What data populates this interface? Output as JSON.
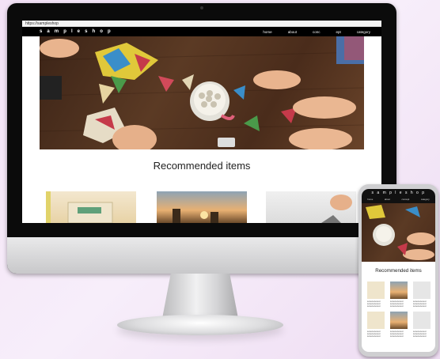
{
  "browser": {
    "url": "https://sampleshop"
  },
  "site": {
    "brand": "s a m p l e s h o p",
    "nav": [
      "home",
      "about",
      "conc",
      "ept",
      "category"
    ]
  },
  "main": {
    "section_title": "Recommended items"
  },
  "mobile": {
    "brand": "s a m p l e s h o p",
    "nav": [
      "home",
      "about",
      "concept",
      "category"
    ],
    "section_title": "Recommended items",
    "item_text": "textextextextext\ntextextextextext\ntextextextextext"
  },
  "colors": {
    "background": "#f3e2f6",
    "navbar": "#000000",
    "table": "#4a2c1b"
  }
}
